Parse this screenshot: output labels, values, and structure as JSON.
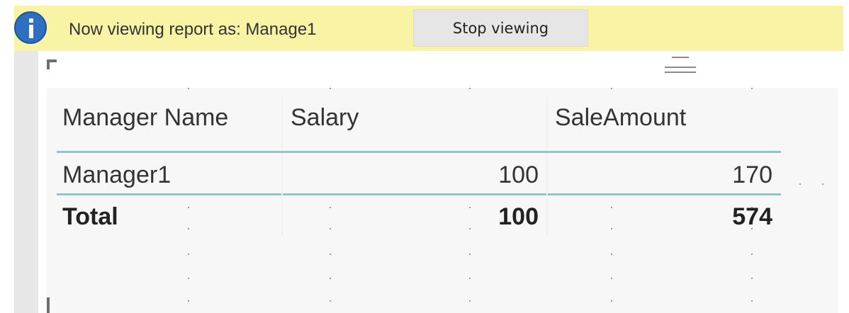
{
  "banner": {
    "message": "Now viewing report as: Manage1",
    "stop_label": "Stop viewing",
    "color": "#f9f3a6",
    "icon": "info-icon"
  },
  "table": {
    "columns": [
      "Manager Name",
      "Salary",
      "SaleAmount"
    ],
    "rows": [
      {
        "name": "Manager1",
        "salary": "100",
        "sale_amount": "170"
      }
    ],
    "total": {
      "label": "Total",
      "salary": "100",
      "sale_amount": "574"
    },
    "accent": "#7ccfcf"
  }
}
